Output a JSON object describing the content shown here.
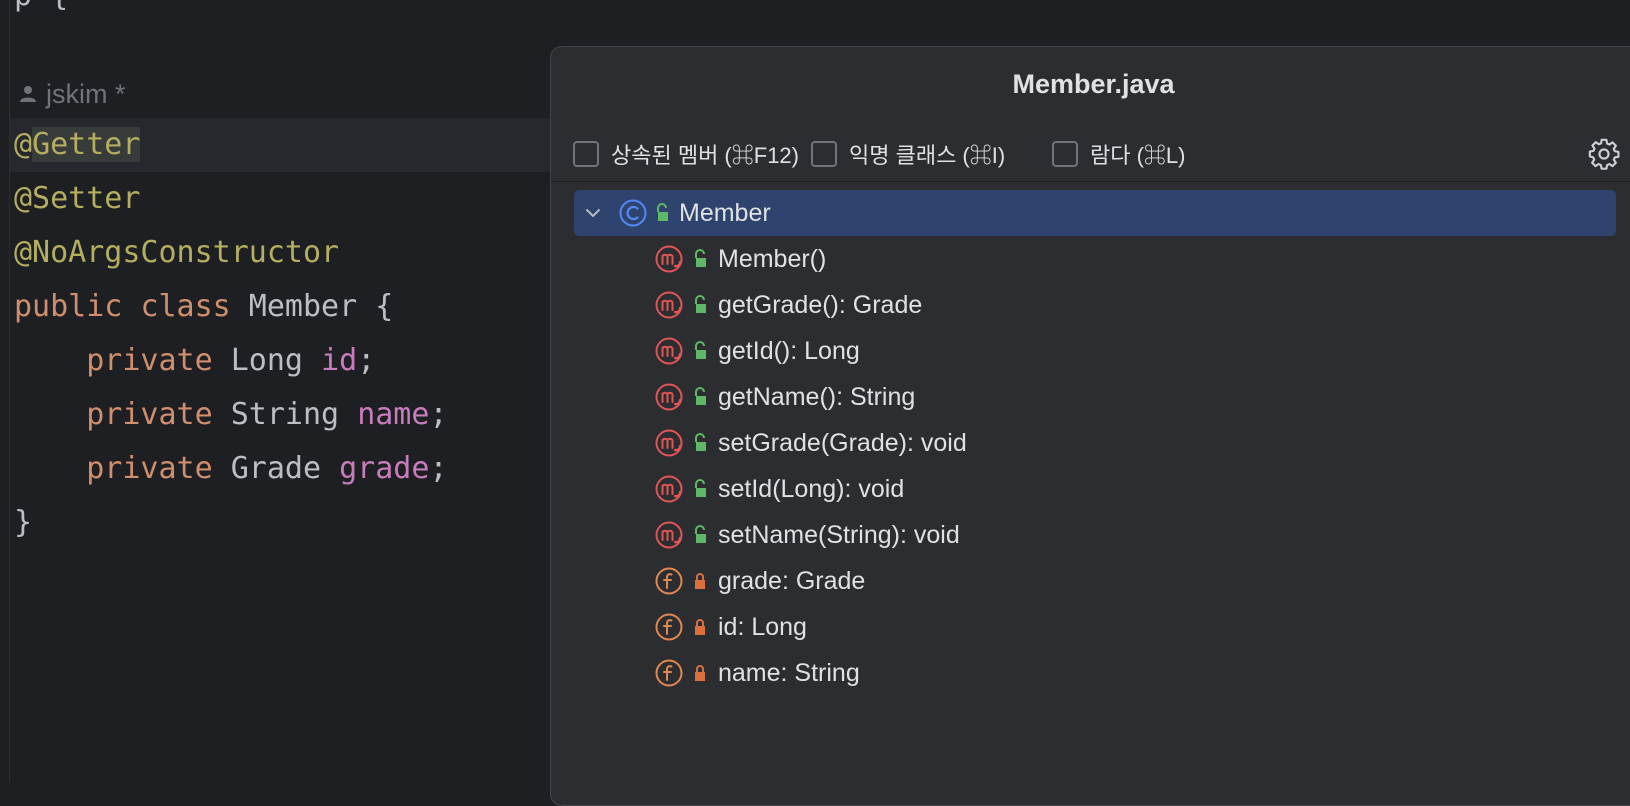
{
  "editor": {
    "top_clipped_text": "p                    {",
    "author": "jskim *",
    "lines": [
      {
        "parts": [
          {
            "t": "@",
            "c": "ann"
          },
          {
            "t": "Getter",
            "c": "ann hl"
          }
        ]
      },
      {
        "parts": [
          {
            "t": "@Setter",
            "c": "ann"
          }
        ]
      },
      {
        "parts": [
          {
            "t": "@NoArgsConstructor",
            "c": "ann"
          }
        ]
      },
      {
        "parts": [
          {
            "t": "public",
            "c": "kw"
          },
          {
            "t": " "
          },
          {
            "t": "class",
            "c": "kw"
          },
          {
            "t": " Member {"
          }
        ]
      },
      {
        "parts": [
          {
            "t": "    "
          },
          {
            "t": "private",
            "c": "kw"
          },
          {
            "t": " Long "
          },
          {
            "t": "id",
            "c": "fld"
          },
          {
            "t": ";"
          }
        ]
      },
      {
        "parts": [
          {
            "t": "    "
          },
          {
            "t": "private",
            "c": "kw"
          },
          {
            "t": " String "
          },
          {
            "t": "name",
            "c": "fld"
          },
          {
            "t": ";"
          }
        ]
      },
      {
        "parts": [
          {
            "t": "    "
          },
          {
            "t": "private",
            "c": "kw"
          },
          {
            "t": " Grade "
          },
          {
            "t": "grade",
            "c": "fld"
          },
          {
            "t": ";"
          }
        ]
      },
      {
        "parts": [
          {
            "t": "}"
          }
        ]
      }
    ]
  },
  "structure_popup": {
    "title": "Member.java",
    "options": [
      {
        "label": "상속된 멤버 (⌘F12)",
        "checked": false
      },
      {
        "label": "익명 클래스 (⌘I)",
        "checked": false
      },
      {
        "label": "람다 (⌘L)",
        "checked": false
      }
    ],
    "settings_icon": "gear-icon",
    "tree": {
      "root": {
        "label": "Member",
        "icon": "class-icon",
        "visibility": "public",
        "expanded": true,
        "selected": true
      },
      "children": [
        {
          "label": "Member()",
          "icon": "method-icon",
          "visibility": "public"
        },
        {
          "label": "getGrade(): Grade",
          "icon": "method-icon",
          "visibility": "public"
        },
        {
          "label": "getId(): Long",
          "icon": "method-icon",
          "visibility": "public"
        },
        {
          "label": "getName(): String",
          "icon": "method-icon",
          "visibility": "public"
        },
        {
          "label": "setGrade(Grade): void",
          "icon": "method-icon",
          "visibility": "public"
        },
        {
          "label": "setId(Long): void",
          "icon": "method-icon",
          "visibility": "public"
        },
        {
          "label": "setName(String): void",
          "icon": "method-icon",
          "visibility": "public"
        },
        {
          "label": "grade: Grade",
          "icon": "field-icon",
          "visibility": "private"
        },
        {
          "label": "id: Long",
          "icon": "field-icon",
          "visibility": "private"
        },
        {
          "label": "name: String",
          "icon": "field-icon",
          "visibility": "private"
        }
      ]
    }
  },
  "colors": {
    "background": "#1e1f22",
    "popup_background": "#2b2d30",
    "selection": "#2e436e",
    "annotation": "#b3ae60",
    "keyword": "#cf8e6d",
    "field": "#c77dbb",
    "method_icon": "#e05555",
    "field_icon": "#e0884f",
    "class_icon": "#548af7",
    "public_lock": "#5fb865",
    "private_lock": "#d9703e"
  }
}
